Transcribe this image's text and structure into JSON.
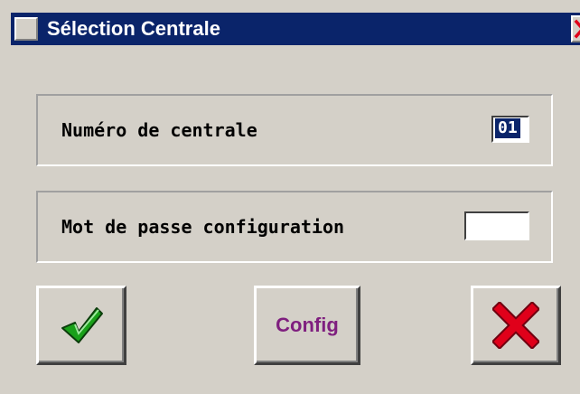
{
  "window": {
    "title": "Sélection Centrale",
    "icon": "window-icon",
    "close_icon": "close-icon"
  },
  "central": {
    "label": "Numéro de centrale",
    "value": "01"
  },
  "password": {
    "label": "Mot de passe configuration",
    "value": ""
  },
  "buttons": {
    "ok_icon": "checkmark-icon",
    "config_label": "Config",
    "cancel_icon": "cross-icon"
  },
  "colors": {
    "titlebar": "#0a246a",
    "config_text": "#7f1f7f",
    "check_green": "#1aa01a",
    "cross_red": "#e0001a"
  }
}
